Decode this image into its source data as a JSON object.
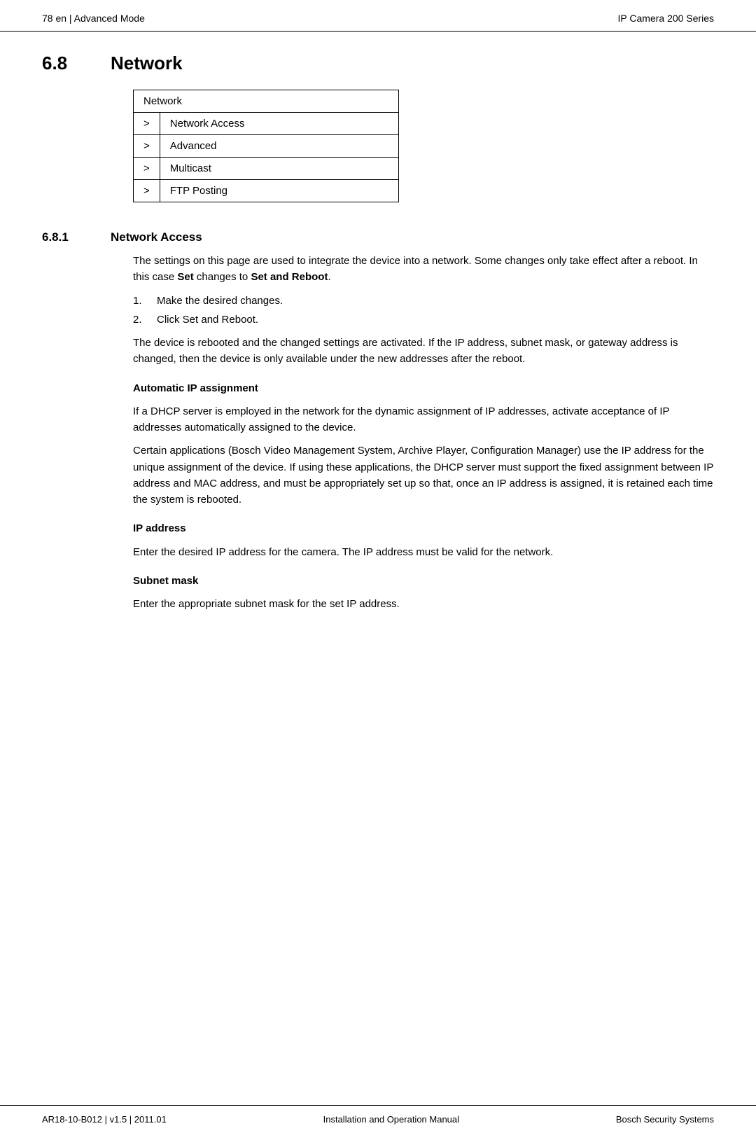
{
  "header": {
    "left": "78   en | Advanced Mode",
    "right": "IP Camera 200 Series"
  },
  "section": {
    "number": "6.8",
    "title": "Network",
    "table": {
      "header": "Network",
      "rows": [
        {
          "arrow": ">",
          "label": "Network Access"
        },
        {
          "arrow": ">",
          "label": "Advanced"
        },
        {
          "arrow": ">",
          "label": "Multicast"
        },
        {
          "arrow": ">",
          "label": "FTP Posting"
        }
      ]
    }
  },
  "subsection": {
    "number": "6.8.1",
    "title": "Network Access",
    "intro1": "The settings on this page are used to integrate the device into a network. Some changes only take effect after a reboot. In this case ",
    "intro1_bold1": "Set",
    "intro1_mid": " changes to ",
    "intro1_bold2": "Set and Reboot",
    "intro1_end": ".",
    "steps": [
      {
        "num": "1.",
        "text": "Make the desired changes."
      },
      {
        "num": "2.",
        "text": "Click ",
        "bold": "Set and Reboot",
        "end": "."
      }
    ],
    "para2": "The device is rebooted and the changed settings are activated. If the IP address, subnet mask, or gateway address is changed, then the device is only available under the new addresses after the reboot.",
    "sub1": {
      "heading": "Automatic IP assignment",
      "para1": "If a DHCP server is employed in the network for the dynamic assignment of IP addresses, activate acceptance of IP addresses automatically assigned to the device.",
      "para2": "Certain applications (Bosch Video Management System, Archive Player, Configuration Manager) use the IP address for the unique assignment of the device. If using these applications, the DHCP server must support the fixed assignment between IP address and MAC address, and must be appropriately set up so that, once an IP address is assigned, it is retained each time the system is rebooted."
    },
    "sub2": {
      "heading": "IP address",
      "para1": "Enter the desired IP address for the camera. The IP address must be valid for the network."
    },
    "sub3": {
      "heading": "Subnet mask",
      "para1": "Enter the appropriate subnet mask for the set IP address."
    }
  },
  "footer": {
    "left": "AR18-10-B012 | v1.5 | 2011.01",
    "center": "Installation and Operation Manual",
    "right": "Bosch Security Systems"
  }
}
